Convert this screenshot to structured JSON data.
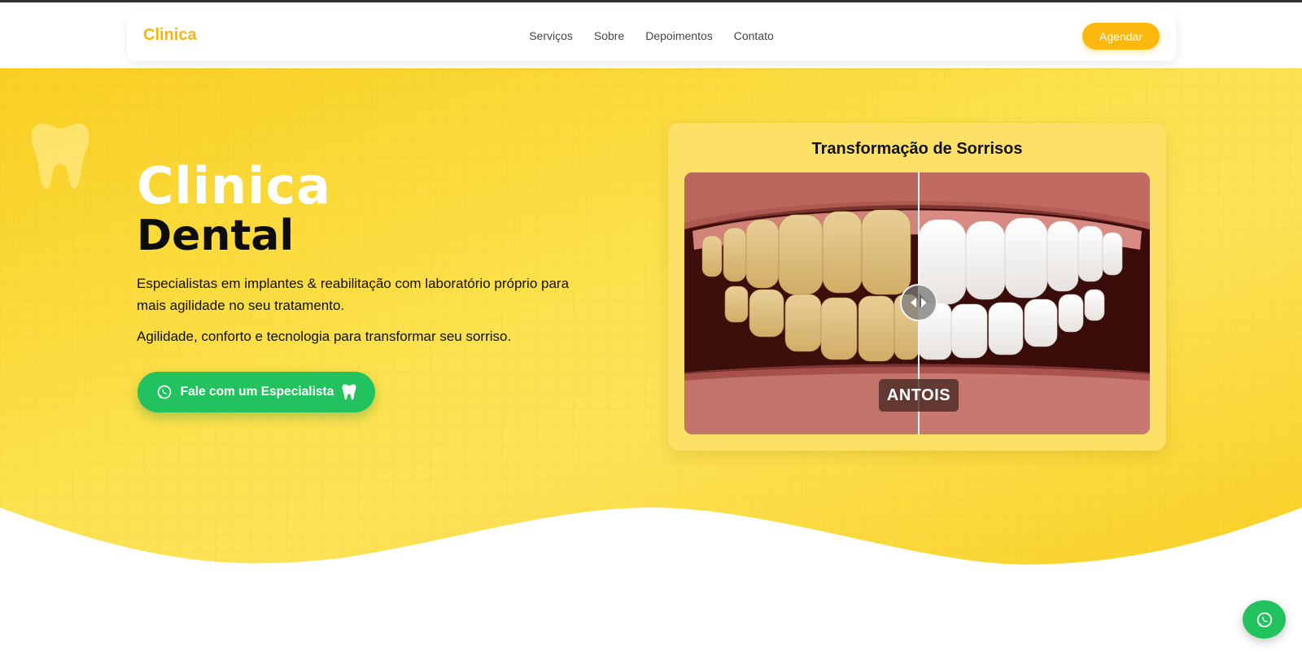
{
  "header": {
    "brand": "Clinica",
    "nav": [
      "Serviços",
      "Sobre",
      "Depoimentos",
      "Contato"
    ],
    "cta_label": "Agendar"
  },
  "hero": {
    "title_line1": "Clinica",
    "title_line2": "Dental",
    "description": "Especialistas em implantes & reabilitação com laboratório próprio para mais agilidade no seu tratamento.",
    "tagline": "Agilidade, conforto e tecnologia para transformar seu sorriso.",
    "cta_label": "Fale com um Especialista"
  },
  "comparison": {
    "title": "Transformação de Sorrisos",
    "label": "ANTOIS",
    "slider_position": 0.5
  },
  "colors": {
    "accent": "#fcb80c",
    "hero_bg": "#fde256",
    "whatsapp": "#22c35e"
  },
  "icons": [
    "whatsapp-icon",
    "tooth-icon",
    "arrow-left-icon",
    "arrow-right-icon"
  ]
}
